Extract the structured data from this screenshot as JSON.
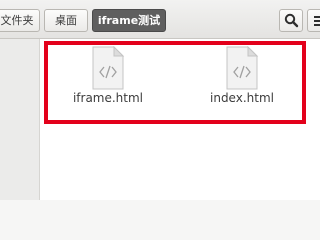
{
  "breadcrumbs": [
    {
      "label": "文件夹"
    },
    {
      "label": "桌面"
    },
    {
      "label": "iframe测试"
    }
  ],
  "toolbar": {
    "search_icon": "search-icon",
    "menu_icon": "hamburger-menu-icon"
  },
  "files": [
    {
      "name": "iframe.html",
      "icon": "html-file-icon"
    },
    {
      "name": "index.html",
      "icon": "html-file-icon"
    }
  ],
  "colors": {
    "selection_outline": "#e3001b",
    "active_crumb_bg": "#5f5f5f"
  }
}
